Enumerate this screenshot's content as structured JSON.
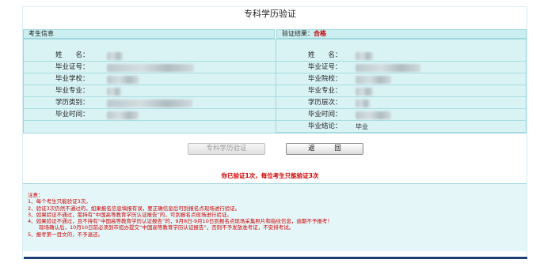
{
  "page_title": "专科学历验证",
  "student_section": {
    "header": "考生信息"
  },
  "result_section": {
    "header_prefix": "验证结果：",
    "result": "合格"
  },
  "left_rows": [
    {
      "label": "姓　　名："
    },
    {
      "label": "毕业证号："
    },
    {
      "label": "毕业学校："
    },
    {
      "label": "毕业专业："
    },
    {
      "label": "学历类别："
    },
    {
      "label": "毕业时间："
    }
  ],
  "right_rows": [
    {
      "label": "姓　　名："
    },
    {
      "label": "毕业证号："
    },
    {
      "label": "毕业院校："
    },
    {
      "label": "毕业专业："
    },
    {
      "label": "学历层次："
    },
    {
      "label": "毕业时间："
    },
    {
      "label": "毕业结论：",
      "value": "毕业"
    }
  ],
  "buttons": {
    "verify": "专科学历验证",
    "back": "返　回"
  },
  "warning": "你已验证1次，每位考生只能验证3次",
  "notes": {
    "title": "注意：",
    "lines": [
      "1、每个考生只能验证3次。",
      "2、验证3次仍然不通过的，如果报名信息填报有误，要正确信息后可到报名点现场进行验证。",
      "3、如果验证不通过，需持有“中国高等教育学历认证报告”的，可到报名点现场进行验证。",
      "4、如果验证不通过，且不持有“中国高等教育学历认证报告”的，9月8日-9月10日到报名点现场采集照片和指纹信息，逾期不予报考！",
      "现场确认后，10月10日前必须到市招办提交“中国高等教育学历认证报告”，否则不予发放准考证，不安排考试。",
      "5、报考第一目文的，不予退还。"
    ]
  },
  "colors": {
    "accent": "#d00000",
    "header_bg": "#cbeef0",
    "grid_bg": "#d9f3f5",
    "bottom_bar": "#1e3f74"
  }
}
